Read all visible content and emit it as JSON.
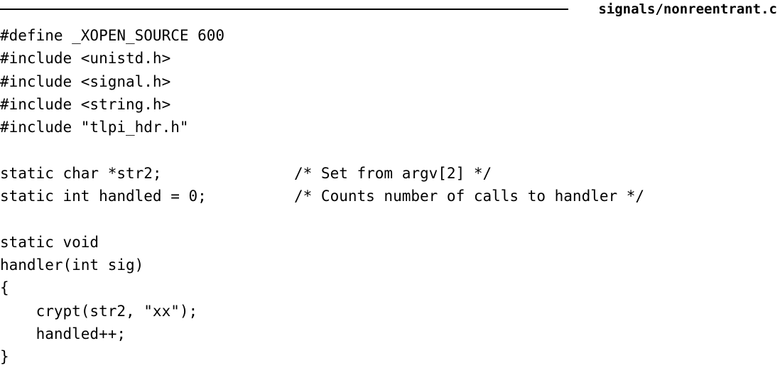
{
  "listing": {
    "filename": "signals/nonreentrant.c",
    "lines": [
      {
        "code": "#define _XOPEN_SOURCE 600",
        "comment": ""
      },
      {
        "code": "#include <unistd.h>",
        "comment": ""
      },
      {
        "code": "#include <signal.h>",
        "comment": ""
      },
      {
        "code": "#include <string.h>",
        "comment": ""
      },
      {
        "code": "#include \"tlpi_hdr.h\"",
        "comment": ""
      },
      {
        "code": "",
        "comment": ""
      },
      {
        "code": "static char *str2;",
        "comment": "/* Set from argv[2] */"
      },
      {
        "code": "static int handled = 0;",
        "comment": "/* Counts number of calls to handler */"
      },
      {
        "code": "",
        "comment": ""
      },
      {
        "code": "static void",
        "comment": ""
      },
      {
        "code": "handler(int sig)",
        "comment": ""
      },
      {
        "code": "{",
        "comment": ""
      },
      {
        "code": "    crypt(str2, \"xx\");",
        "comment": ""
      },
      {
        "code": "    handled++;",
        "comment": ""
      },
      {
        "code": "}",
        "comment": ""
      }
    ]
  }
}
